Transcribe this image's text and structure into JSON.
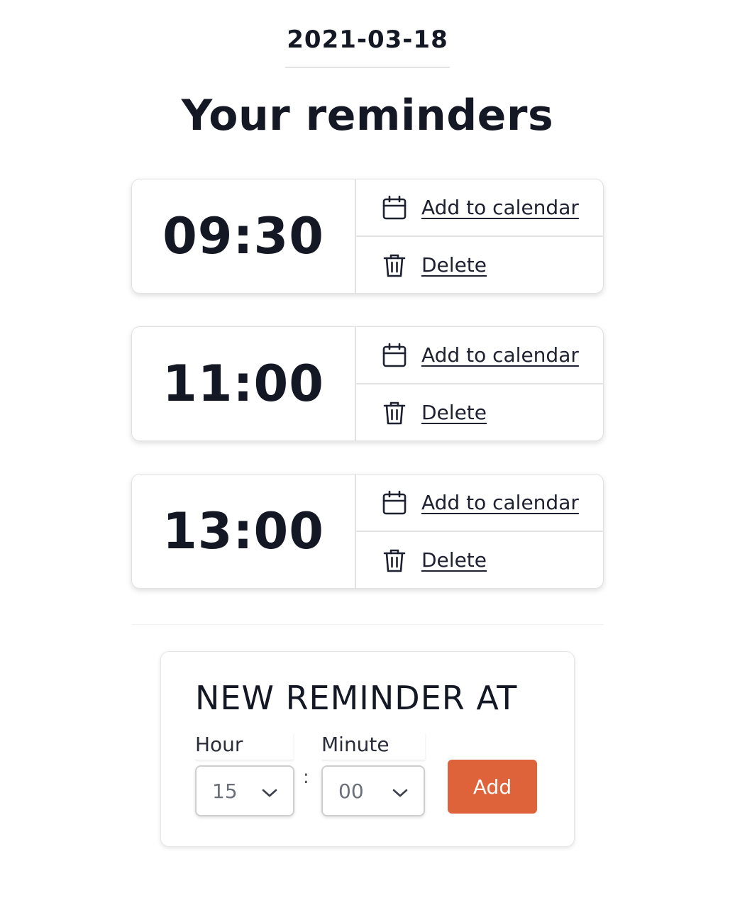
{
  "date": "2021-03-18",
  "title": "Your reminders",
  "reminders": [
    {
      "time": "09:30",
      "calendar_label": "Add to calendar",
      "delete_label": "Delete"
    },
    {
      "time": "11:00",
      "calendar_label": "Add to calendar",
      "delete_label": "Delete"
    },
    {
      "time": "13:00",
      "calendar_label": "Add to calendar",
      "delete_label": "Delete"
    }
  ],
  "new_reminder": {
    "title": "NEW REMINDER AT",
    "hour_label": "Hour",
    "hour_value": "15",
    "separator": ":",
    "minute_label": "Minute",
    "minute_value": "00",
    "add_label": "Add"
  },
  "icons": {
    "calendar": "calendar-icon",
    "delete": "trash-icon",
    "dropdown": "chevron-down-icon"
  },
  "colors": {
    "accent": "#de633a",
    "text": "#141824",
    "border": "#e2e2e2"
  }
}
